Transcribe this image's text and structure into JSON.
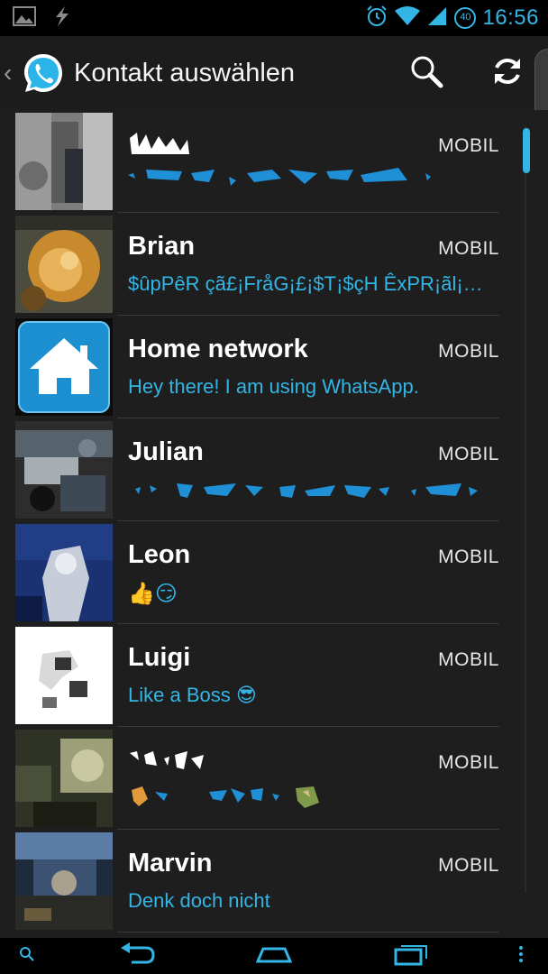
{
  "status_bar": {
    "time": "16:56",
    "battery": "40",
    "icons": [
      "image-icon",
      "flash-icon",
      "alarm-icon",
      "wifi-icon",
      "signal-icon",
      "battery-icon"
    ]
  },
  "action_bar": {
    "title": "Kontakt auswählen",
    "icons": [
      "whatsapp-logo",
      "search-icon",
      "refresh-icon"
    ]
  },
  "contacts": [
    {
      "name": "",
      "status": "",
      "type": "MOBIL"
    },
    {
      "name": "Brian",
      "status": "$ûpPêR çã£¡FråG¡£¡$T¡$çH ÊxPR¡ãl¡…",
      "type": "MOBIL"
    },
    {
      "name": "Home network",
      "status": "Hey there! I am using WhatsApp.",
      "type": "MOBIL"
    },
    {
      "name": "Julian",
      "status": "",
      "type": "MOBIL"
    },
    {
      "name": "Leon",
      "status": "👍😏",
      "type": "MOBIL"
    },
    {
      "name": "Luigi",
      "status": "Like a Boss 😎",
      "type": "MOBIL"
    },
    {
      "name": "",
      "status": "",
      "type": "MOBIL"
    },
    {
      "name": "Marvin",
      "status": "Denk doch nicht",
      "type": "MOBIL"
    }
  ],
  "nav_bar": {
    "icons": [
      "search-icon",
      "back-icon",
      "home-icon",
      "recent-apps-icon",
      "menu-icon"
    ]
  },
  "colors": {
    "accent": "#33b5e5",
    "background": "#1e1e1e",
    "status_bar": "#000000"
  }
}
